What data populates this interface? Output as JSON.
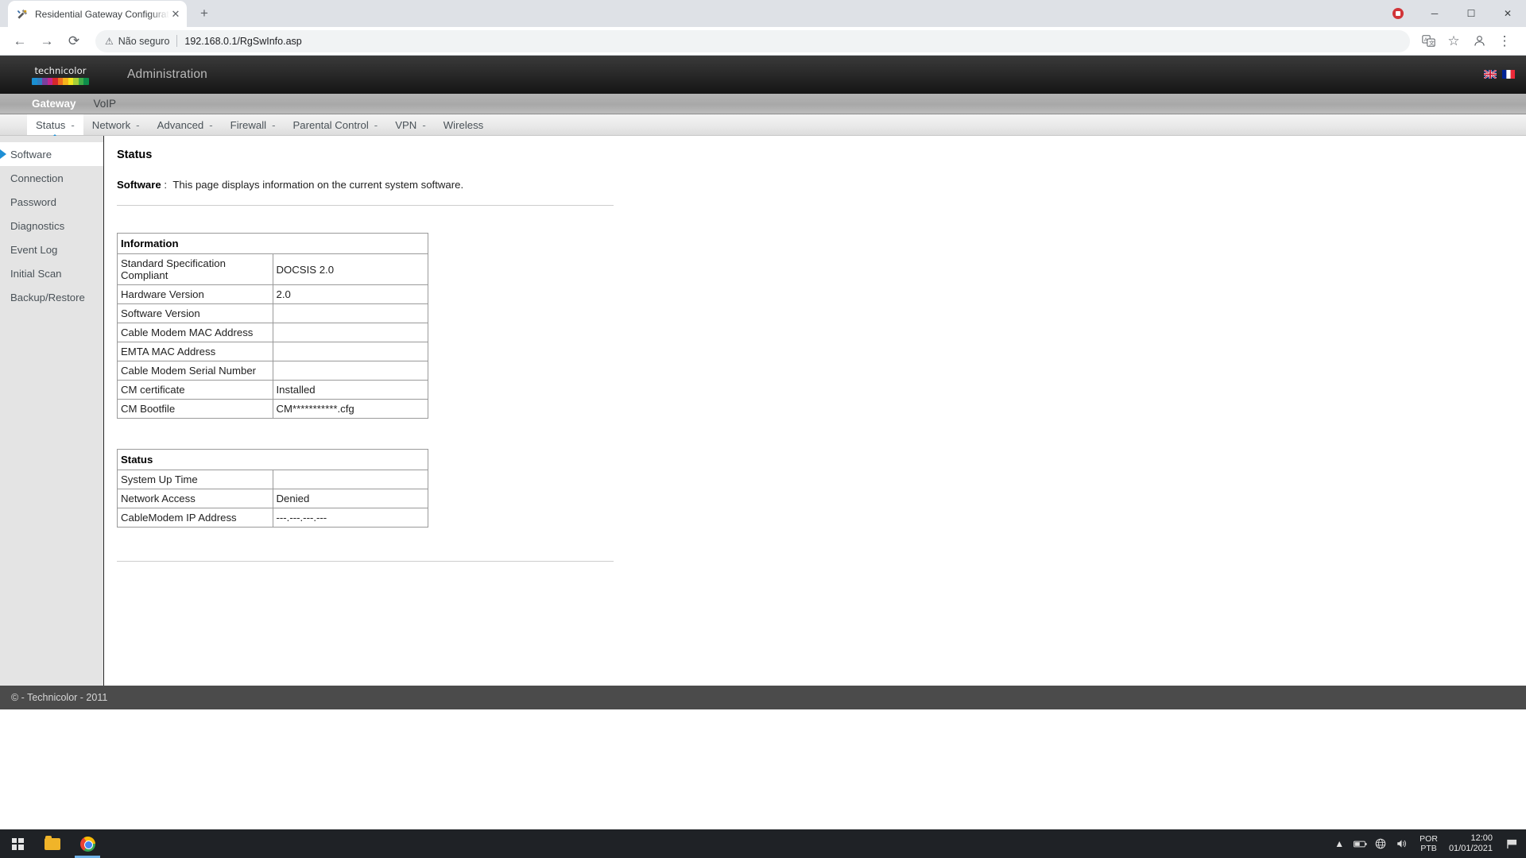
{
  "browser": {
    "tab": {
      "title": "Residential Gateway Configuration",
      "favicon_icon": "tools-hammer-wrench-icon",
      "close_icon": "close-icon"
    },
    "new_tab_label": "+",
    "window_controls": {
      "record_icon": "recording-stop-icon",
      "minimize_label": "─",
      "maximize_label": "☐",
      "close_label": "✕"
    },
    "nav": {
      "back_icon": "arrow-left-icon",
      "forward_icon": "arrow-right-icon",
      "reload_icon": "reload-icon"
    },
    "omnibox": {
      "security_icon": "not-secure-warning-icon",
      "security_label": "Não seguro",
      "url": "192.168.0.1/RgSwInfo.asp"
    },
    "omnibox_right": {
      "translate_icon": "translate-icon",
      "bookmark_icon": "star-icon",
      "profile_icon": "profile-avatar-icon",
      "menu_icon": "three-dots-menu-icon"
    }
  },
  "gateway": {
    "brand": {
      "logo_text": "technicolor",
      "logo_bar_colors": [
        "#1a8fd1",
        "#2f7fc0",
        "#7b3f9d",
        "#c2268f",
        "#d6282b",
        "#ef6f1f",
        "#f5b31b",
        "#f3e61d",
        "#a6ce39",
        "#3fae49",
        "#0e8c4a"
      ]
    },
    "header_title": "Administration",
    "flags": [
      {
        "name": "flag-uk",
        "colors": [
          "#012169",
          "#ffffff",
          "#c8102e"
        ]
      },
      {
        "name": "flag-france",
        "colors": [
          "#002395",
          "#ffffff",
          "#ed2939"
        ]
      }
    ],
    "nav_primary": [
      {
        "label": "Gateway",
        "active": true
      },
      {
        "label": "VoIP",
        "active": false
      }
    ],
    "nav_secondary": [
      {
        "label": "Status",
        "caret": "-",
        "active": true
      },
      {
        "label": "Network",
        "caret": "-",
        "active": false
      },
      {
        "label": "Advanced",
        "caret": "-",
        "active": false
      },
      {
        "label": "Firewall",
        "caret": "-",
        "active": false
      },
      {
        "label": "Parental Control",
        "caret": "-",
        "active": false
      },
      {
        "label": "VPN",
        "caret": "-",
        "active": false
      },
      {
        "label": "Wireless",
        "caret": "",
        "active": false
      }
    ],
    "sidebar": [
      {
        "label": "Software",
        "active": true
      },
      {
        "label": "Connection",
        "active": false
      },
      {
        "label": "Password",
        "active": false
      },
      {
        "label": "Diagnostics",
        "active": false
      },
      {
        "label": "Event Log",
        "active": false
      },
      {
        "label": "Initial Scan",
        "active": false
      },
      {
        "label": "Backup/Restore",
        "active": false
      }
    ],
    "content": {
      "title": "Status",
      "desc_label": "Software",
      "desc_colon": ":",
      "desc_text": "This page displays information on the current system software.",
      "information_table": {
        "header": "Information",
        "rows": [
          {
            "key": "Standard Specification Compliant",
            "value": "DOCSIS 2.0"
          },
          {
            "key": "Hardware Version",
            "value": "2.0"
          },
          {
            "key": "Software Version",
            "value": ""
          },
          {
            "key": "Cable Modem MAC Address",
            "value": ""
          },
          {
            "key": "EMTA MAC Address",
            "value": ""
          },
          {
            "key": "Cable Modem Serial Number",
            "value": ""
          },
          {
            "key": "CM certificate",
            "value": "Installed"
          },
          {
            "key": "CM Bootfile",
            "value": "CM***********.cfg"
          }
        ]
      },
      "status_table": {
        "header": "Status",
        "rows": [
          {
            "key": "System Up Time",
            "value": ""
          },
          {
            "key": "Network Access",
            "value": "Denied"
          },
          {
            "key": "CableModem IP Address",
            "value": "---.---.---.---"
          }
        ]
      }
    },
    "footer": "© - Technicolor - 2011"
  },
  "taskbar": {
    "start_icon": "windows-start-icon",
    "explorer_icon": "file-explorer-icon",
    "chrome_icon": "chrome-icon",
    "tray": {
      "chevron_icon": "chevron-up-icon",
      "battery_icon": "battery-icon",
      "network_icon": "network-globe-icon",
      "volume_icon": "volume-icon",
      "lang_line1": "POR",
      "lang_line2": "PTB",
      "time": "12:00",
      "date": "01/01/2021",
      "notifications_icon": "notification-flag-icon"
    }
  }
}
